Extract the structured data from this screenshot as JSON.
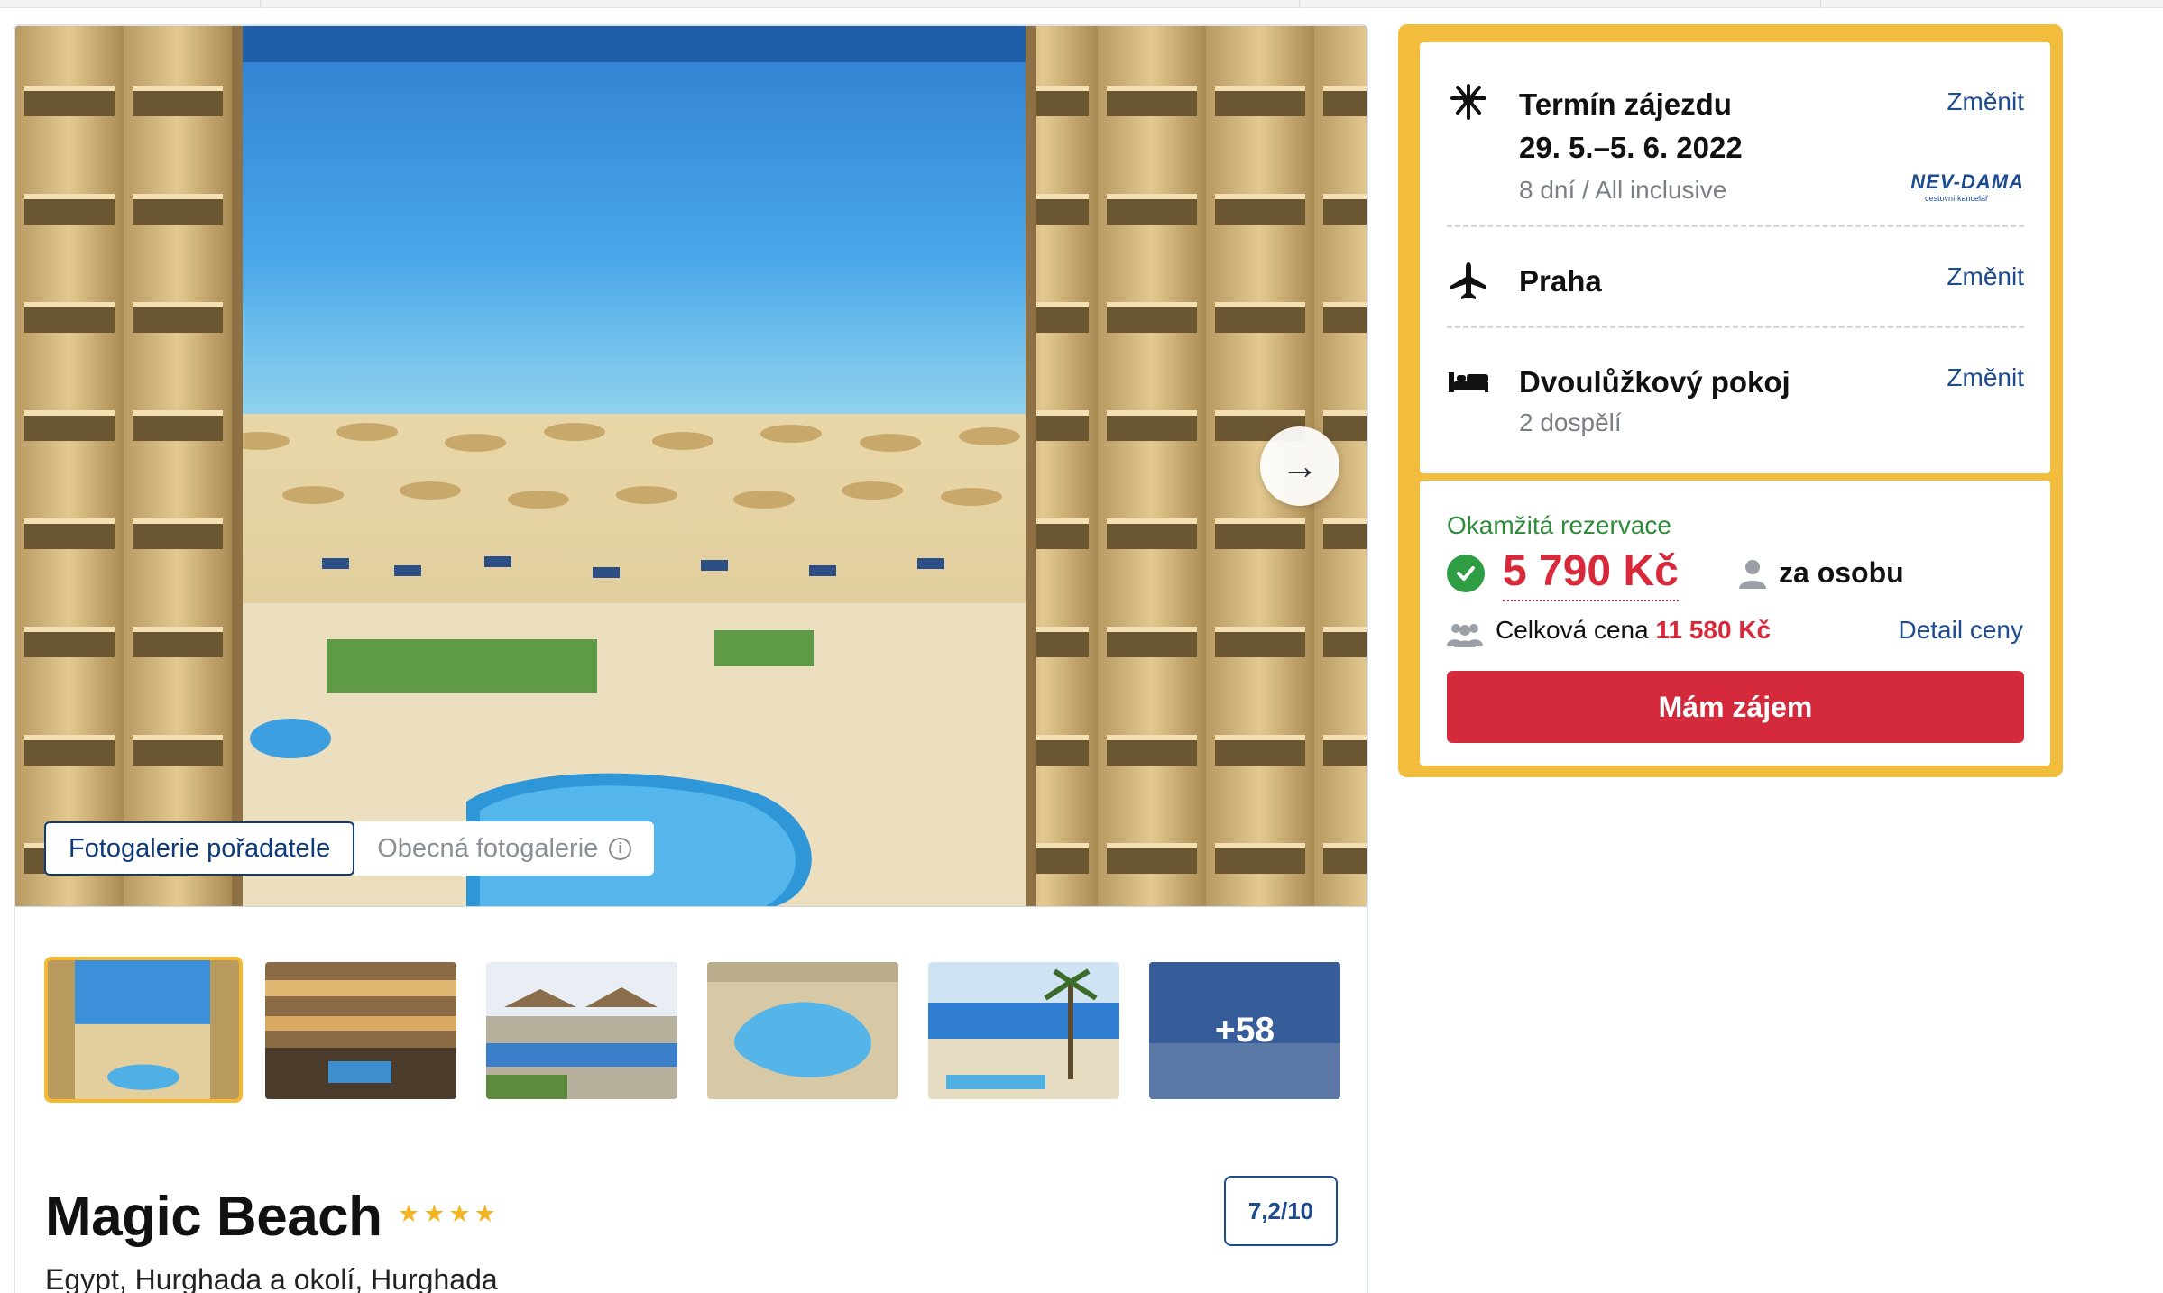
{
  "gallery": {
    "tabs": [
      {
        "label": "Fotogalerie pořadatele",
        "active": true
      },
      {
        "label": "Obecná fotogalerie",
        "active": false
      }
    ],
    "more_photos_label": "+58",
    "thumbnail_count": 6,
    "selected_thumbnail": 1
  },
  "hotel": {
    "name": "Magic Beach",
    "stars": "★★★★",
    "rating": "7,2/10",
    "location": "Egypt, Hurghada a okolí, Hurghada"
  },
  "trip": {
    "term": {
      "title": "Termín zájezdu",
      "dates": "29. 5.–5. 6. 2022",
      "detail": "8 dní / All inclusive",
      "change_label": "Změnit",
      "icon": "sun-icon"
    },
    "operator": {
      "name": "NEV-DAMA",
      "subtitle": "cestovní kancelář"
    },
    "departure": {
      "title": "Praha",
      "change_label": "Změnit",
      "icon": "airplane-icon"
    },
    "room": {
      "title": "Dvoulůžkový pokoj",
      "detail": "2 dospělí",
      "change_label": "Změnit",
      "icon": "bed-icon"
    }
  },
  "booking": {
    "instant_label": "Okamžitá rezervace",
    "price": "5 790 Kč",
    "per_person_label": "za osobu",
    "total_label": "Celková cena",
    "total_value": "11 580 Kč",
    "detail_label": "Detail ceny",
    "cta_label": "Mám zájem"
  },
  "colors": {
    "accent_yellow": "#f2bd3c",
    "link_blue": "#1d4b8f",
    "price_red": "#d9283a",
    "cta_red": "#d42a3c",
    "success_green": "#2e9d43"
  }
}
